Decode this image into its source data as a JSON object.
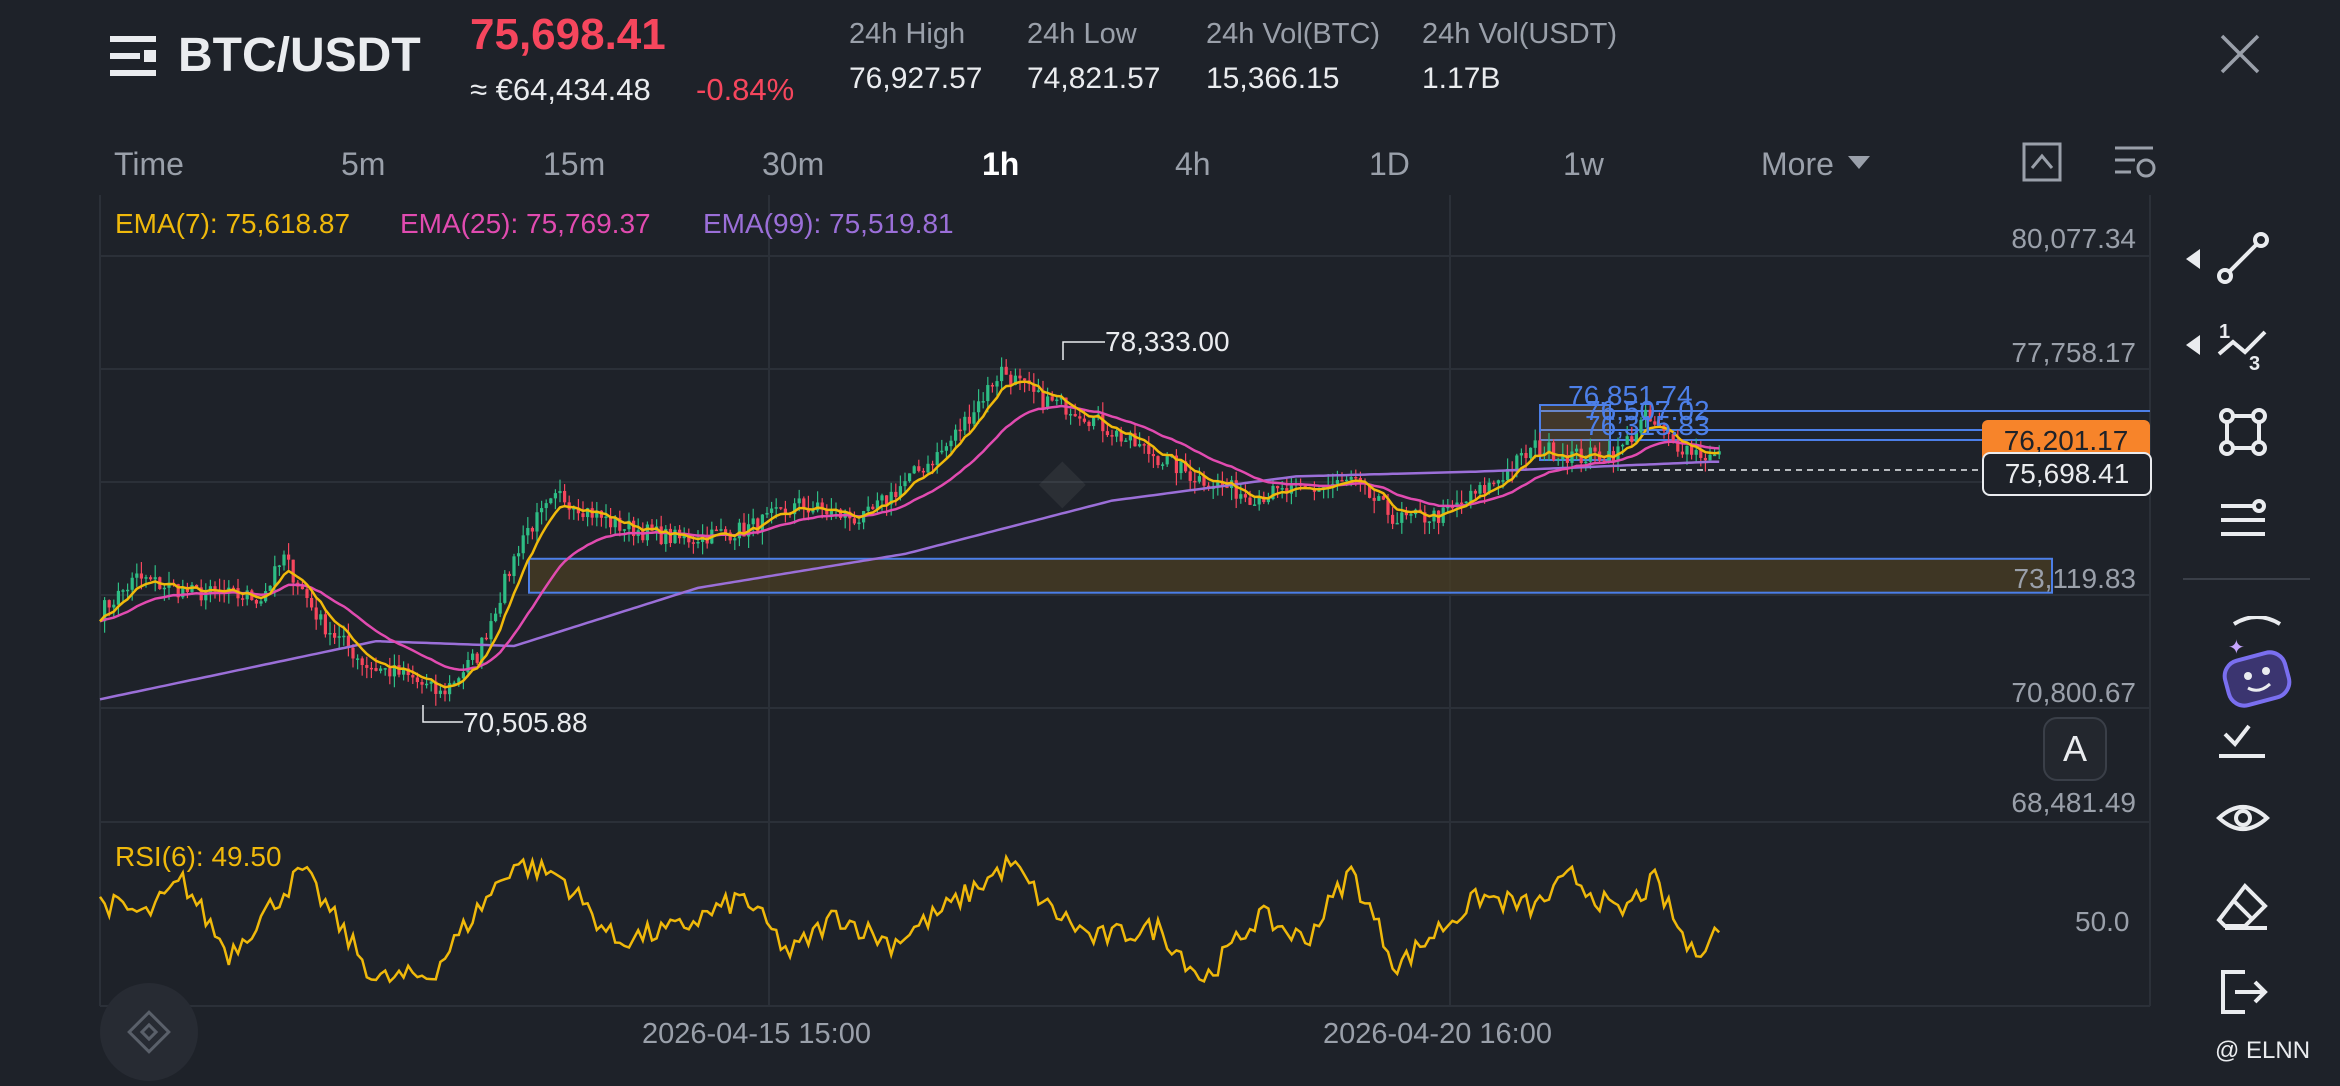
{
  "header": {
    "pair": "BTC/USDT",
    "last_price": "75,698.41",
    "fiat_price": "≈ €64,434.48",
    "change_pct": "-0.84%",
    "stats": [
      {
        "label": "24h High",
        "value": "76,927.57"
      },
      {
        "label": "24h Low",
        "value": "74,821.57"
      },
      {
        "label": "24h Vol(BTC)",
        "value": "15,366.15"
      },
      {
        "label": "24h Vol(USDT)",
        "value": "1.17B"
      }
    ]
  },
  "timeframes": [
    "Time",
    "5m",
    "15m",
    "30m",
    "1h",
    "4h",
    "1D",
    "1w",
    "More"
  ],
  "active_timeframe": "1h",
  "indicators": {
    "ema7": "EMA(7): 75,618.87",
    "ema25": "EMA(25): 75,769.37",
    "ema99": "EMA(99): 75,519.81",
    "rsi": "RSI(6): 49.50",
    "rsi_level": "50.0"
  },
  "colors": {
    "ema7": "#f0b90b",
    "ema25": "#e14bb0",
    "ema99": "#9b6fd8",
    "up": "#2ebd85",
    "down": "#f6465d",
    "drawing": "#4c7fe8",
    "tag": "#f7842a"
  },
  "annotations": {
    "high": "78,333.00",
    "low": "70,505.88",
    "blue_labels": [
      "76,851.74",
      "76,507.02",
      "76,315.83"
    ],
    "orange_tag": "76,201.17",
    "current_tag": "75,698.41",
    "a_button": "A"
  },
  "chart_data": {
    "type": "candlestick",
    "y_axis_ticks": [
      "80,077.34",
      "77,758.17",
      "75,698.41",
      "73,119.83",
      "70,800.67",
      "68,481.49"
    ],
    "x_axis_ticks": [
      "2026-04-15 15:00",
      "2026-04-20 16:00"
    ],
    "ylim": [
      68481.49,
      80077.34
    ],
    "zone_price_range": [
      72800,
      73500
    ],
    "close_path": [
      {
        "i": 0,
        "p": 72400
      },
      {
        "i": 8,
        "p": 73100
      },
      {
        "i": 20,
        "p": 72800
      },
      {
        "i": 35,
        "p": 72700
      },
      {
        "i": 40,
        "p": 73500
      },
      {
        "i": 48,
        "p": 72200
      },
      {
        "i": 58,
        "p": 71300
      },
      {
        "i": 66,
        "p": 71100
      },
      {
        "i": 74,
        "p": 70700
      },
      {
        "i": 82,
        "p": 71500
      },
      {
        "i": 92,
        "p": 74000
      },
      {
        "i": 100,
        "p": 74800
      },
      {
        "i": 112,
        "p": 74200
      },
      {
        "i": 126,
        "p": 73900
      },
      {
        "i": 140,
        "p": 74100
      },
      {
        "i": 152,
        "p": 74600
      },
      {
        "i": 166,
        "p": 74300
      },
      {
        "i": 174,
        "p": 75000
      },
      {
        "i": 184,
        "p": 75800
      },
      {
        "i": 196,
        "p": 77400
      },
      {
        "i": 204,
        "p": 76800
      },
      {
        "i": 212,
        "p": 76600
      },
      {
        "i": 224,
        "p": 75900
      },
      {
        "i": 238,
        "p": 75200
      },
      {
        "i": 250,
        "p": 74800
      },
      {
        "i": 262,
        "p": 74900
      },
      {
        "i": 272,
        "p": 75100
      },
      {
        "i": 282,
        "p": 74300
      },
      {
        "i": 292,
        "p": 74400
      },
      {
        "i": 302,
        "p": 75000
      },
      {
        "i": 312,
        "p": 75800
      },
      {
        "i": 322,
        "p": 75600
      },
      {
        "i": 330,
        "p": 75700
      },
      {
        "i": 336,
        "p": 76400
      },
      {
        "i": 342,
        "p": 75900
      },
      {
        "i": 350,
        "p": 75600
      }
    ],
    "ema99_path": [
      {
        "i": 0,
        "p": 70600
      },
      {
        "i": 60,
        "p": 71800
      },
      {
        "i": 90,
        "p": 71700
      },
      {
        "i": 130,
        "p": 72900
      },
      {
        "i": 175,
        "p": 73600
      },
      {
        "i": 220,
        "p": 74700
      },
      {
        "i": 260,
        "p": 75200
      },
      {
        "i": 300,
        "p": 75300
      },
      {
        "i": 350,
        "p": 75500
      }
    ],
    "rsi_path": [
      {
        "i": 0,
        "p": 60
      },
      {
        "i": 10,
        "p": 55
      },
      {
        "i": 18,
        "p": 68
      },
      {
        "i": 28,
        "p": 40
      },
      {
        "i": 44,
        "p": 72
      },
      {
        "i": 60,
        "p": 30
      },
      {
        "i": 72,
        "p": 32
      },
      {
        "i": 80,
        "p": 52
      },
      {
        "i": 90,
        "p": 75
      },
      {
        "i": 100,
        "p": 70
      },
      {
        "i": 112,
        "p": 45
      },
      {
        "i": 126,
        "p": 50
      },
      {
        "i": 140,
        "p": 62
      },
      {
        "i": 150,
        "p": 40
      },
      {
        "i": 160,
        "p": 55
      },
      {
        "i": 172,
        "p": 44
      },
      {
        "i": 186,
        "p": 60
      },
      {
        "i": 198,
        "p": 75
      },
      {
        "i": 206,
        "p": 58
      },
      {
        "i": 216,
        "p": 46
      },
      {
        "i": 230,
        "p": 50
      },
      {
        "i": 240,
        "p": 30
      },
      {
        "i": 252,
        "p": 55
      },
      {
        "i": 262,
        "p": 45
      },
      {
        "i": 272,
        "p": 72
      },
      {
        "i": 282,
        "p": 35
      },
      {
        "i": 290,
        "p": 48
      },
      {
        "i": 300,
        "p": 62
      },
      {
        "i": 312,
        "p": 58
      },
      {
        "i": 320,
        "p": 70
      },
      {
        "i": 330,
        "p": 55
      },
      {
        "i": 338,
        "p": 68
      },
      {
        "i": 346,
        "p": 40
      },
      {
        "i": 352,
        "p": 50
      }
    ]
  },
  "watermark": "@ ELNN"
}
